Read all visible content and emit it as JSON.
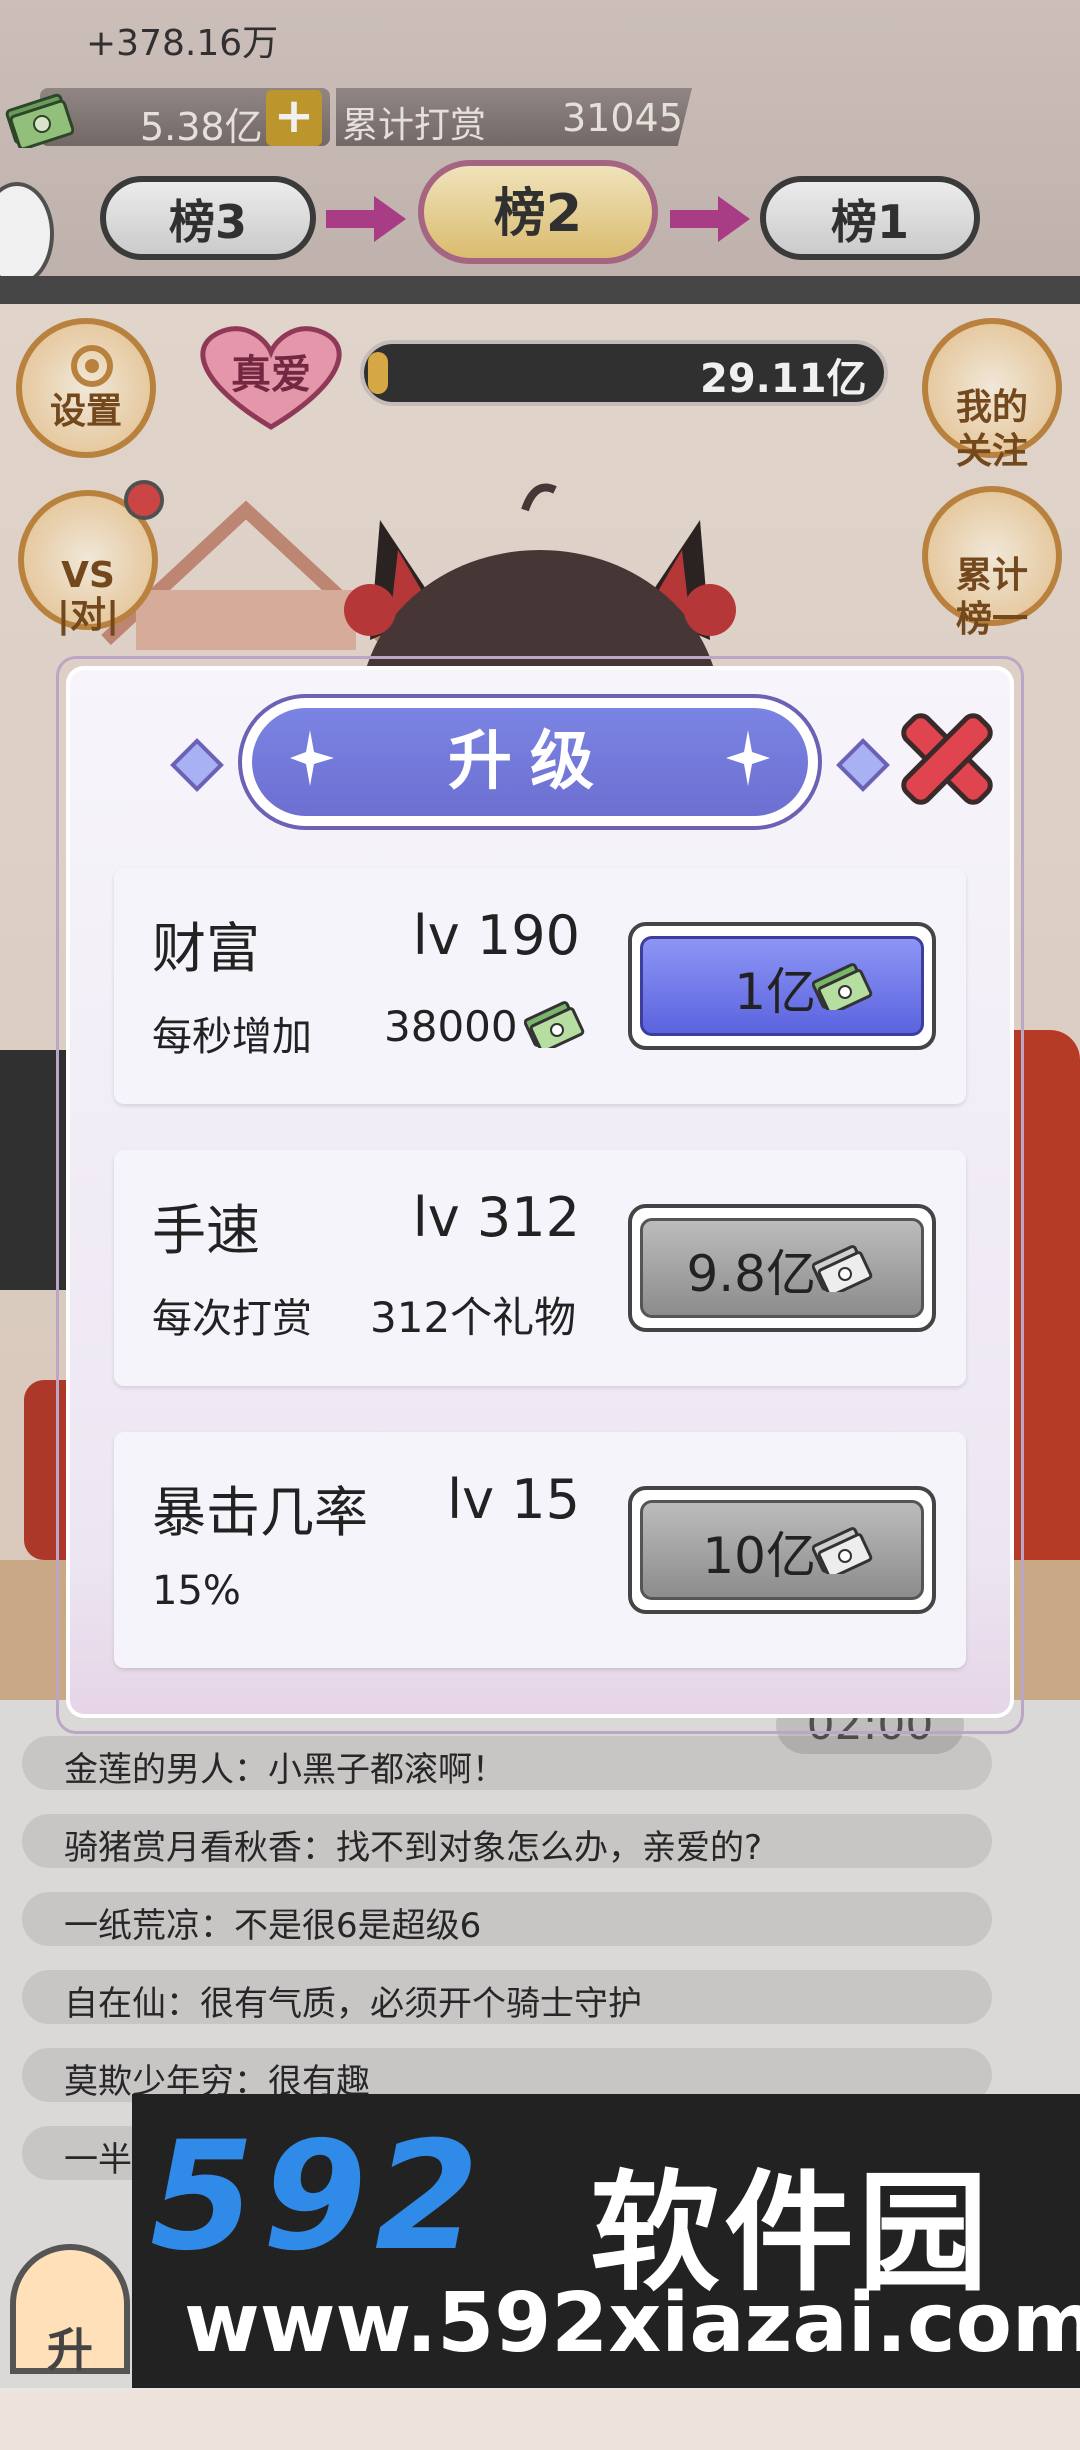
{
  "hud": {
    "delta": "+378.16万",
    "money": "5.38亿",
    "plus": "+",
    "total_label": "累计打赏",
    "total_value": "31045"
  },
  "ranks": {
    "rank3": "榜3",
    "rank2": "榜2",
    "rank1": "榜1"
  },
  "side_buttons": {
    "settings": "设置",
    "vs": "VS\n|对|",
    "follow": "我的\n关注",
    "cumulative": "累计\n榜一"
  },
  "love": {
    "badge": "真爱",
    "value": "29.11亿",
    "progress": 0.04
  },
  "modal": {
    "title": "升级",
    "items": [
      {
        "name": "财富",
        "level": "lv 190",
        "desc": "每秒增加",
        "value": "38000",
        "price": "1亿",
        "state": "affordable"
      },
      {
        "name": "手速",
        "level": "lv 312",
        "desc": "每次打赏",
        "value": "312个礼物",
        "price": "9.8亿",
        "state": "locked"
      },
      {
        "name": "暴击几率",
        "level": "lv 15",
        "desc": "15%",
        "value": "",
        "price": "10亿",
        "state": "locked"
      }
    ]
  },
  "chat": {
    "timer": "02:00",
    "messages": [
      "金莲的男人：小黑子都滚啊！",
      "骑猪赏月看秋香：找不到对象怎么办，亲爱的?",
      "一纸荒凉：不是很6是超级6",
      "自在仙：很有气质，必须开个骑士守护",
      "莫欺少年穷：很有趣",
      "一半"
    ]
  },
  "bottom": {
    "upgrade_button": "升"
  },
  "watermark": {
    "logo": "592",
    "name": "软件园",
    "url": "www.592xiazai.com"
  },
  "colors": {
    "accent_purple": "#6d6fd1",
    "close_red": "#e0454f",
    "gold": "#e4b24a"
  }
}
